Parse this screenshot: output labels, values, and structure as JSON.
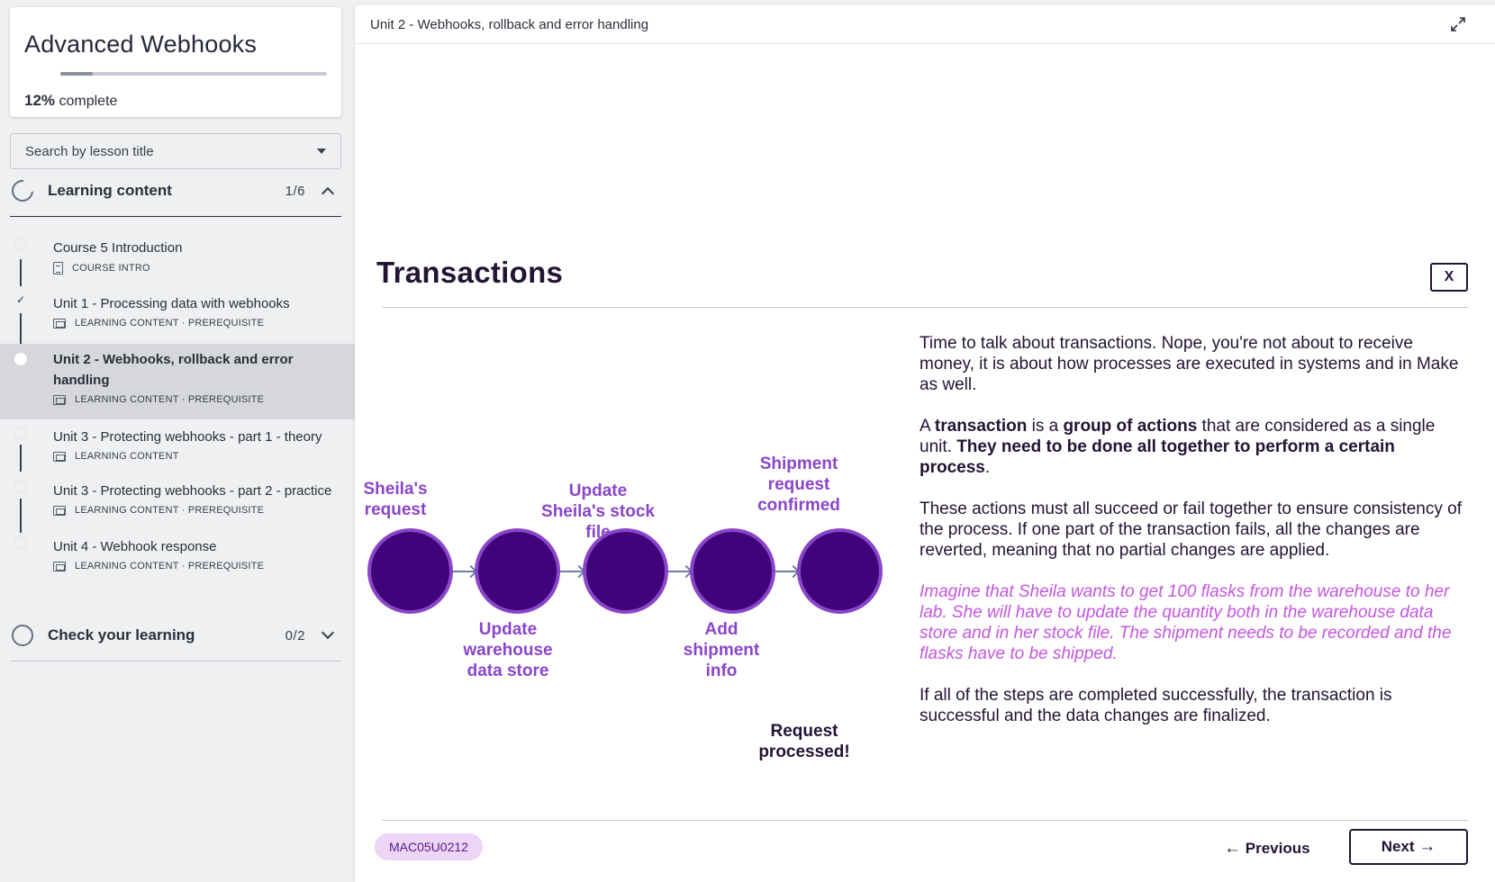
{
  "sidebar": {
    "course_title": "Advanced Webhooks",
    "progress_percent": 12,
    "progress_value": "12%",
    "progress_suffix": "complete",
    "search_placeholder": "Search by lesson title",
    "sections": [
      {
        "label": "Learning content",
        "count": "1/6",
        "expanded": true
      },
      {
        "label": "Check your learning",
        "count": "0/2",
        "expanded": false
      }
    ],
    "lessons": [
      {
        "title": "Course 5 Introduction",
        "meta": "COURSE INTRO",
        "status": "todo"
      },
      {
        "title": "Unit 1 - Processing data with webhooks",
        "meta": "LEARNING CONTENT · PREREQUISITE",
        "status": "done"
      },
      {
        "title": "Unit 2 - Webhooks, rollback and error handling",
        "meta": "LEARNING CONTENT · PREREQUISITE",
        "status": "current"
      },
      {
        "title": "Unit 3 - Protecting webhooks - part 1 - theory",
        "meta": "LEARNING CONTENT",
        "status": "todo"
      },
      {
        "title": "Unit 3 - Protecting webhooks - part 2 - practice",
        "meta": "LEARNING CONTENT · PREREQUISITE",
        "status": "todo"
      },
      {
        "title": "Unit 4 - Webhook response",
        "meta": "LEARNING CONTENT · PREREQUISITE",
        "status": "todo"
      }
    ]
  },
  "main": {
    "breadcrumb": "Unit 2 - Webhooks, rollback and error handling",
    "slide_title": "Transactions",
    "close_label": "X",
    "diagram": {
      "labels_top": [
        "Sheila's request",
        "Update Sheila's stock file",
        "Shipment request confirmed"
      ],
      "labels_bottom": [
        "Update warehouse data store",
        "Add shipment info"
      ],
      "final_label": "Request processed!",
      "colors": {
        "circle_fill": "#3f0479",
        "circle_border": "#8a45c9",
        "label": "#8a45c9",
        "connector": "#6b7fa8"
      }
    },
    "paragraphs": {
      "p1": "Time to talk about transactions. Nope, you're not about to receive money, it is about how processes are executed in systems and in Make as well.",
      "p2_a": "A ",
      "p2_b": "transaction",
      "p2_c": " is a ",
      "p2_d": "group of actions",
      "p2_e": " that are considered as a single unit. ",
      "p2_f": "They need to be done all together to perform a certain process",
      "p2_g": ".",
      "p3": "These actions must all succeed or fail together to ensure consistency of the process. If one part of the transaction fails, all the changes are reverted, meaning that no partial changes are applied.",
      "p4": "Imagine that Sheila wants to get 100 flasks from the warehouse to her lab. She will have to update the quantity both in the warehouse data store and in her stock file. The shipment needs to be recorded and the flasks have to be shipped.",
      "p5": "If all of the steps are completed successfully, the transaction is successful and the data changes are finalized."
    },
    "code_badge": "MAC05U0212",
    "prev_label": "Previous",
    "next_label": "Next",
    "accent_color": "#c455e0"
  }
}
